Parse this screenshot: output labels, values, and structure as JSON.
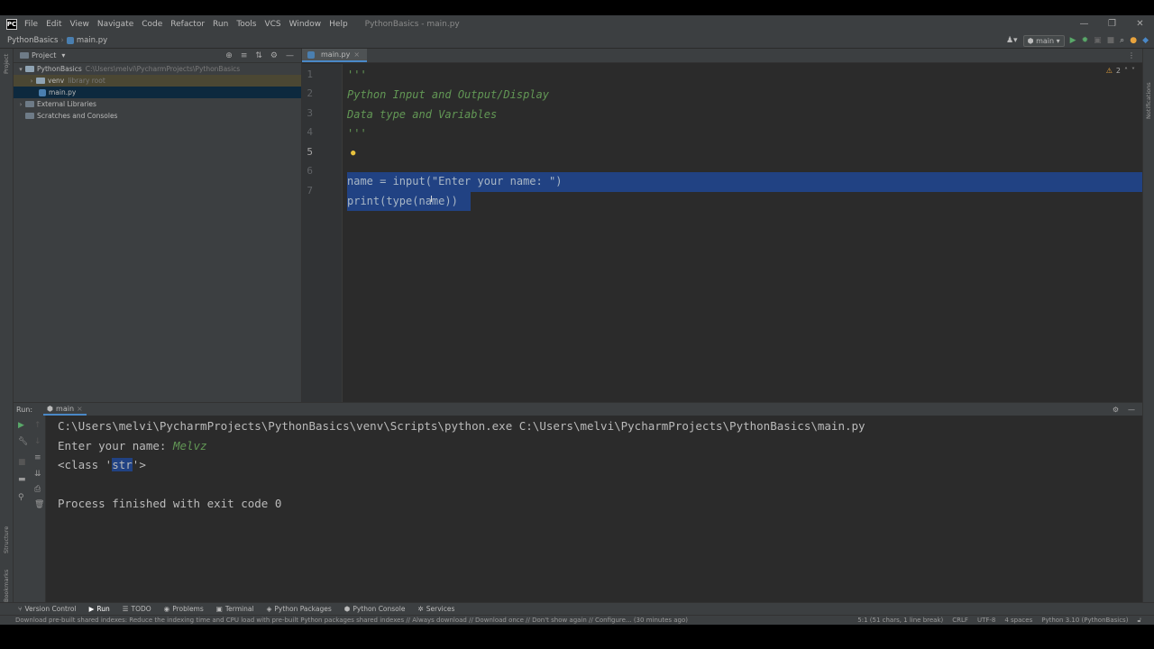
{
  "app": {
    "window_title": "PythonBasics - main.py"
  },
  "menu": [
    "File",
    "Edit",
    "View",
    "Navigate",
    "Code",
    "Refactor",
    "Run",
    "Tools",
    "VCS",
    "Window",
    "Help"
  ],
  "nav": {
    "project": "PythonBasics",
    "file": "main.py",
    "run_config": "main"
  },
  "project_panel": {
    "title": "Project",
    "root": "PythonBasics",
    "root_path": "C:\\Users\\melvi\\PycharmProjects\\PythonBasics",
    "venv": "venv",
    "venv_note": "library root",
    "file": "main.py",
    "external": "External Libraries",
    "scratches": "Scratches and Consoles"
  },
  "editor": {
    "tab": "main.py",
    "warnings": "2",
    "line_numbers": [
      "1",
      "2",
      "3",
      "4",
      "5",
      "6",
      "7"
    ],
    "lines": {
      "l1": "'''",
      "l2": "Python Input and Output/Display",
      "l3": "Data type and Variables",
      "l4": "'''",
      "l5": "name = input(\"Enter your name: \")",
      "l6": "print(type(name))",
      "l7": ""
    }
  },
  "run": {
    "label": "Run:",
    "tab": "main",
    "cmd": "C:\\Users\\melvi\\PycharmProjects\\PythonBasics\\venv\\Scripts\\python.exe C:\\Users\\melvi\\PycharmProjects\\PythonBasics\\main.py",
    "prompt": "Enter your name: ",
    "input_value": "Melvz",
    "class_pre": "<class '",
    "class_hl": "str",
    "class_post": "'>",
    "finished": "Process finished with exit code 0"
  },
  "tool_windows": [
    "Version Control",
    "Run",
    "TODO",
    "Problems",
    "Terminal",
    "Python Packages",
    "Python Console",
    "Services"
  ],
  "side_labels": {
    "project": "Project",
    "structure": "Structure",
    "bookmarks": "Bookmarks",
    "notifications": "Notifications"
  },
  "status": {
    "message": "Download pre-built shared indexes: Reduce the indexing time and CPU load with pre-built Python packages shared indexes // Always download // Download once // Don't show again // Configure... (30 minutes ago)",
    "position": "5:1 (51 chars, 1 line break)",
    "line_sep": "CRLF",
    "encoding": "UTF-8",
    "indent": "4 spaces",
    "interpreter": "Python 3.10 (PythonBasics)"
  },
  "colors": {
    "accent": "#214283",
    "comment": "#629755",
    "bg": "#2b2b2b",
    "chrome": "#3c3f41"
  }
}
